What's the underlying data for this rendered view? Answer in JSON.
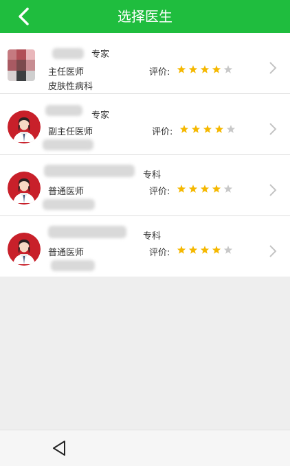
{
  "header": {
    "title": "选择医生"
  },
  "doctors": [
    {
      "level": "专家",
      "title": "主任医师",
      "department": "皮肤性病科",
      "rating_label": "评价:",
      "rating": 4,
      "rating_max": 5
    },
    {
      "level": "专家",
      "title": "副主任医师",
      "department": "",
      "rating_label": "评价:",
      "rating": 4,
      "rating_max": 5
    },
    {
      "level": "专科",
      "title": "普通医师",
      "department": "",
      "rating_label": "评价:",
      "rating": 4,
      "rating_max": 5
    },
    {
      "level": "专科",
      "title": "普通医师",
      "department": "",
      "rating_label": "评价:",
      "rating": 4,
      "rating_max": 5
    }
  ],
  "colors": {
    "header_bg": "#1fbd3e",
    "star_filled": "#f5b800",
    "star_empty": "#c8c8c8",
    "avatar_bg": "#c8202a"
  },
  "icons": {
    "back": "chevron-left-icon",
    "row_arrow": "chevron-right-icon",
    "nav_back": "triangle-back-icon",
    "star": "star-icon"
  }
}
